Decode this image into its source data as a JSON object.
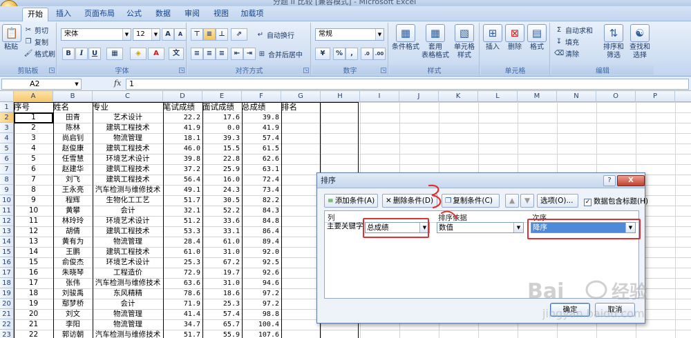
{
  "window": {
    "title": "分题 II 比较 [兼容模式] - Microsoft Excel"
  },
  "tabs": [
    "开始",
    "插入",
    "页面布局",
    "公式",
    "数据",
    "审阅",
    "视图",
    "加载项"
  ],
  "ribbon": {
    "clipboard": {
      "label": "剪贴板",
      "paste": "粘贴",
      "cut": "剪切",
      "copy": "复制",
      "format_painter": "格式刷"
    },
    "font": {
      "label": "字体",
      "name": "宋体",
      "size": "12",
      "bold": "B",
      "italic": "I",
      "underline": "U"
    },
    "alignment": {
      "label": "对齐方式",
      "wrap": "自动换行",
      "merge": "合并后居中"
    },
    "number": {
      "label": "数字",
      "format": "常规"
    },
    "styles": {
      "label": "样式",
      "conditional": "条件格式",
      "table_format": "套用\n表格格式",
      "cell_styles": "单元格\n样式"
    },
    "cells": {
      "label": "单元格",
      "insert": "插入",
      "delete": "删除",
      "format": "格式"
    },
    "editing": {
      "label": "编辑",
      "autosum": "自动求和",
      "fill": "填充",
      "clear": "清除",
      "sort_filter": "排序和\n筛选",
      "find_select": "查找和\n选择"
    }
  },
  "formula_bar": {
    "name_box": "A2",
    "fx": "fx",
    "value": "1"
  },
  "columns": [
    "A",
    "B",
    "C",
    "D",
    "E",
    "F",
    "G",
    "H",
    "I",
    "J",
    "K",
    "L",
    "M",
    "N",
    "O",
    "P"
  ],
  "header_row": [
    "序号",
    "姓名",
    "专业",
    "笔试成绩",
    "面试成绩",
    "总成绩",
    "排名"
  ],
  "rows": [
    [
      "1",
      "田青",
      "艺术设计",
      "22.2",
      "17.6",
      "39.8"
    ],
    [
      "2",
      "陈林",
      "建筑工程技术",
      "41.9",
      "0.0",
      "41.9"
    ],
    [
      "3",
      "尚启钊",
      "物流管理",
      "18.1",
      "39.3",
      "57.4"
    ],
    [
      "4",
      "赵俊康",
      "建筑工程技术",
      "46.0",
      "15.5",
      "61.5"
    ],
    [
      "5",
      "任雪慧",
      "环境艺术设计",
      "39.8",
      "22.8",
      "62.6"
    ],
    [
      "6",
      "赵建华",
      "建筑工程技术",
      "37.2",
      "25.9",
      "63.1"
    ],
    [
      "7",
      "刘飞",
      "建筑工程技术",
      "56.4",
      "16.0",
      "72.4"
    ],
    [
      "8",
      "王永亮",
      "汽车检测与维修技术",
      "49.1",
      "24.3",
      "73.4"
    ],
    [
      "9",
      "程辉",
      "生物化工工艺",
      "51.7",
      "30.5",
      "82.2"
    ],
    [
      "10",
      "黄攀",
      "会计",
      "32.1",
      "52.2",
      "84.3"
    ],
    [
      "11",
      "林玲玲",
      "环境艺术设计",
      "51.2",
      "33.6",
      "84.8"
    ],
    [
      "12",
      "胡倩",
      "建筑工程技术",
      "53.3",
      "33.1",
      "86.4"
    ],
    [
      "13",
      "黄有为",
      "物流管理",
      "28.4",
      "61.0",
      "89.4"
    ],
    [
      "14",
      "王鹏",
      "建筑工程技术",
      "61.0",
      "31.0",
      "92.0"
    ],
    [
      "15",
      "俞俊杰",
      "环境艺术设计",
      "25.3",
      "67.2",
      "92.5"
    ],
    [
      "16",
      "朱晓琴",
      "工程造价",
      "72.9",
      "19.7",
      "92.6"
    ],
    [
      "17",
      "张伟",
      "汽车检测与维修技术",
      "63.6",
      "31.0",
      "94.6"
    ],
    [
      "18",
      "刘骏禹",
      "东风精精",
      "78.6",
      "18.6",
      "97.2"
    ],
    [
      "19",
      "鄢梦桥",
      "会计",
      "71.9",
      "25.3",
      "97.2"
    ],
    [
      "20",
      "刘文",
      "物流管理",
      "41.4",
      "57.4",
      "98.8"
    ],
    [
      "21",
      "李阳",
      "物流管理",
      "34.7",
      "65.7",
      "100.4"
    ],
    [
      "22",
      "郭访朝",
      "汽车检测与维修技术",
      "51.7",
      "55.9",
      "107.6"
    ]
  ],
  "sort_dialog": {
    "title": "排序",
    "help": "?",
    "close": "X",
    "add_level": "添加条件(A)",
    "delete_level": "删除条件(D)",
    "copy_level": "复制条件(C)",
    "up": "▲",
    "down": "▼",
    "options": "选项(O)...",
    "has_headers": "数据包含标题(H)",
    "col_header": "列",
    "sort_on_header": "排序依据",
    "order_header": "次序",
    "primary_key_label": "主要关键字",
    "primary_key_value": "总成绩",
    "sort_on_value": "数值",
    "order_value": "降序",
    "ok": "确定",
    "cancel": "取消"
  },
  "watermark": {
    "brand": "Bai",
    "brand2": "经验",
    "url": "jingyan.baidu.com"
  }
}
